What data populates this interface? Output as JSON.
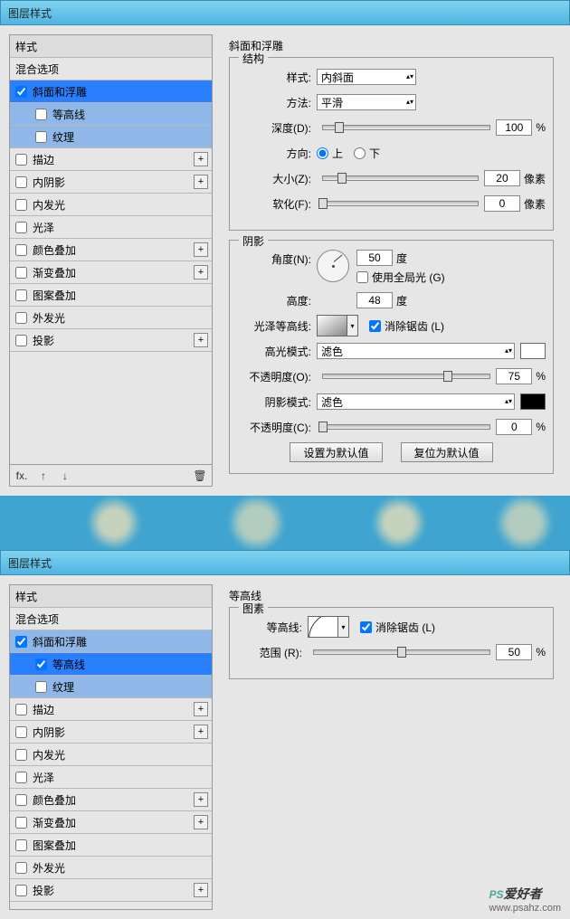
{
  "app_title": "图层样式",
  "sidebar": {
    "header": "样式",
    "blend": "混合选项",
    "items": {
      "bevel": "斜面和浮雕",
      "contour": "等高线",
      "texture": "纹理",
      "stroke": "描边",
      "inner_shadow": "内阴影",
      "inner_glow": "内发光",
      "satin": "光泽",
      "color_overlay": "颜色叠加",
      "gradient_overlay": "渐变叠加",
      "pattern_overlay": "图案叠加",
      "outer_glow": "外发光",
      "drop_shadow": "投影"
    },
    "fx_label": "fx."
  },
  "bevel": {
    "title": "斜面和浮雕",
    "structure_legend": "结构",
    "style_label": "样式:",
    "style_value": "内斜面",
    "technique_label": "方法:",
    "technique_value": "平滑",
    "depth_label": "深度(D):",
    "depth_value": "100",
    "depth_unit": "%",
    "direction_label": "方向:",
    "dir_up": "上",
    "dir_down": "下",
    "size_label": "大小(Z):",
    "size_value": "20",
    "size_unit": "像素",
    "soften_label": "软化(F):",
    "soften_value": "0",
    "soften_unit": "像素",
    "shading_legend": "阴影",
    "angle_label": "角度(N):",
    "angle_value": "50",
    "angle_unit": "度",
    "global_light": "使用全局光 (G)",
    "altitude_label": "高度:",
    "altitude_value": "48",
    "altitude_unit": "度",
    "gloss_contour_label": "光泽等高线:",
    "antialias": "消除锯齿 (L)",
    "highlight_mode_label": "高光模式:",
    "highlight_mode_value": "滤色",
    "highlight_opacity_label": "不透明度(O):",
    "highlight_opacity_value": "75",
    "highlight_opacity_unit": "%",
    "shadow_mode_label": "阴影模式:",
    "shadow_mode_value": "滤色",
    "shadow_opacity_label": "不透明度(C):",
    "shadow_opacity_value": "0",
    "shadow_opacity_unit": "%",
    "set_default": "设置为默认值",
    "reset_default": "复位为默认值"
  },
  "contour_panel": {
    "title": "等高线",
    "elements_legend": "图素",
    "contour_label": "等高线:",
    "antialias": "消除锯齿 (L)",
    "range_label": "范围 (R):",
    "range_value": "50",
    "range_unit": "%"
  },
  "watermark": {
    "main": "PS",
    "cn": "爱好者",
    "url": "www.psahz.com"
  }
}
